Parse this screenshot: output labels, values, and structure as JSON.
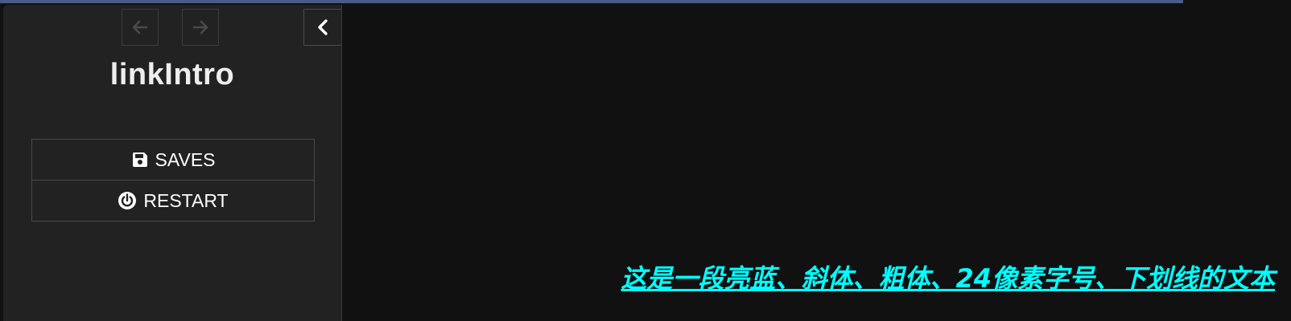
{
  "story": {
    "title": "linkIntro"
  },
  "sidebar": {
    "back_icon": "arrow-left-icon",
    "forward_icon": "arrow-right-icon",
    "collapse_icon": "chevron-left-icon",
    "menu": [
      {
        "label": "SAVES",
        "icon": "floppy-disk-icon"
      },
      {
        "label": "RESTART",
        "icon": "power-icon"
      }
    ]
  },
  "passage": {
    "text": "这是一段亮蓝、斜体、粗体、24像素字号、下划线的文本",
    "text_color": "#00ffff"
  },
  "colors": {
    "background": "#111111",
    "sidebar": "#222222",
    "topbar": "#4b5a86"
  }
}
